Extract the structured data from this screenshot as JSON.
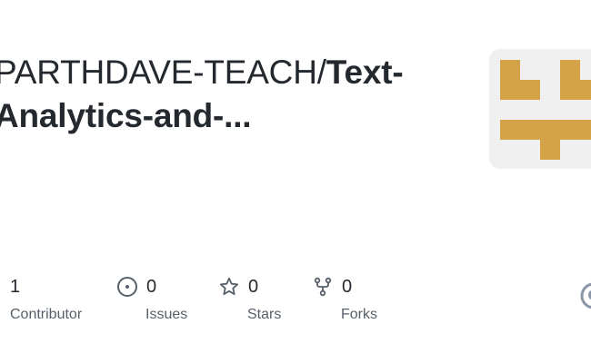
{
  "repo": {
    "owner": "PARTHDAVE-TEACH/",
    "name_line1": "Text-",
    "name_line2": "Analytics-and-..."
  },
  "stats": [
    {
      "value": "1",
      "label": "Contributor",
      "icon": "people-icon"
    },
    {
      "value": "0",
      "label": "Issues",
      "icon": "issue-opened-icon"
    },
    {
      "value": "0",
      "label": "Stars",
      "icon": "star-icon"
    },
    {
      "value": "0",
      "label": "Forks",
      "icon": "repo-forked-icon"
    }
  ],
  "colors": {
    "text": "#24292f",
    "muted": "#57606a",
    "avatar_bg": "#f0f0f0",
    "identicon": "#d4a347"
  }
}
